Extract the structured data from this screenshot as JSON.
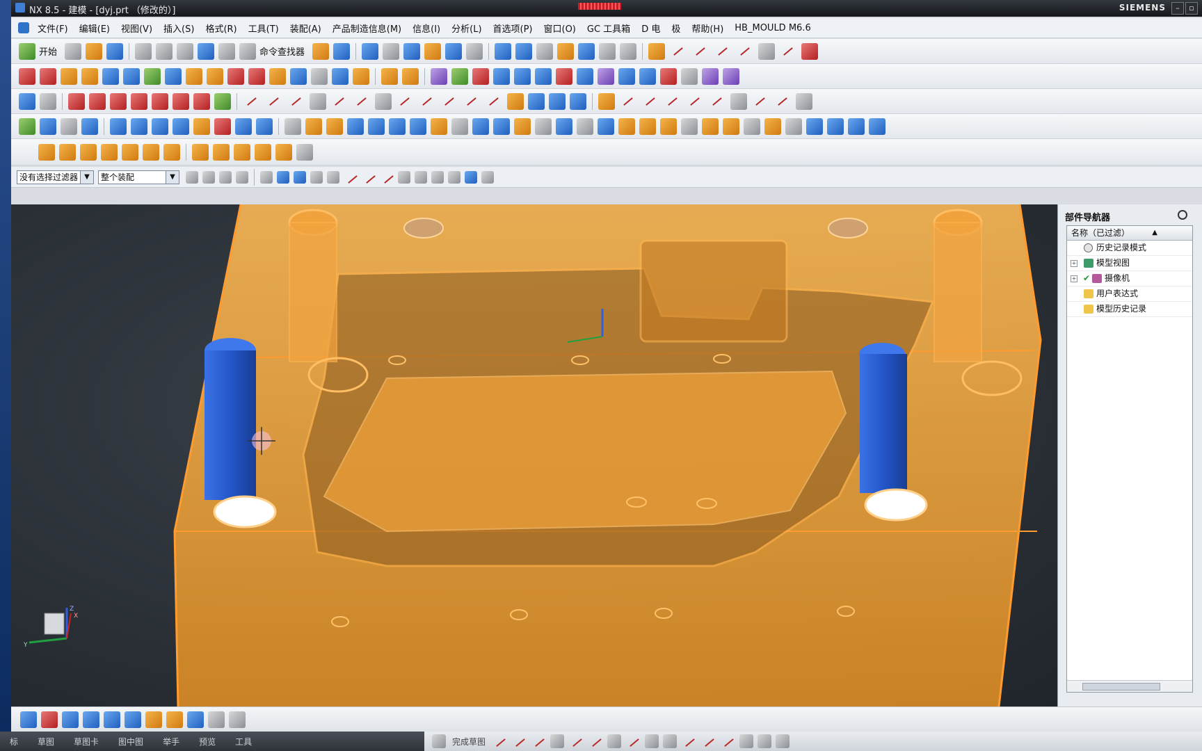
{
  "window": {
    "title": "NX 8.5 - 建模 - [dyj.prt （修改的）]",
    "brand": "SIEMENS",
    "min_button": "–",
    "restore_button": "▫"
  },
  "menubar": {
    "items": [
      "文件(F)",
      "编辑(E)",
      "视图(V)",
      "插入(S)",
      "格式(R)",
      "工具(T)",
      "装配(A)",
      "产品制造信息(M)",
      "信息(I)",
      "分析(L)",
      "首选项(P)",
      "窗口(O)",
      "GC 工具箱",
      "D 电",
      "极",
      "帮助(H)",
      "HB_MOULD M6.6"
    ]
  },
  "toolbar_standard": {
    "start_label": "开始",
    "command_finder_label": "命令查找器"
  },
  "filterbar": {
    "selection_filter": "没有选择过滤器",
    "assembly_scope": "整个装配"
  },
  "part_navigator": {
    "title": "部件导航器",
    "column_header": "名称（已过滤）",
    "sort_indicator": "▲",
    "items": [
      {
        "label": "历史记录模式",
        "icon": "clock-icon",
        "expandable": false,
        "checked": false
      },
      {
        "label": "模型视图",
        "icon": "model-views-icon",
        "expandable": true,
        "checked": false
      },
      {
        "label": "摄像机",
        "icon": "camera-icon",
        "expandable": true,
        "checked": true
      },
      {
        "label": "用户表达式",
        "icon": "folder-icon",
        "expandable": false,
        "checked": false
      },
      {
        "label": "模型历史记录",
        "icon": "folder-icon",
        "expandable": false,
        "checked": false
      }
    ]
  },
  "statusbar_tabs": [
    "标",
    "草图",
    "草图卡",
    "图中图",
    "举手",
    "预览",
    "工具"
  ],
  "sketch_bar": {
    "finish_sketch_label": "完成草图"
  },
  "viewport": {
    "triad_labels": {
      "x": "X",
      "y": "Y",
      "z": "Z"
    },
    "colors": {
      "body_fill": "#f2a23a",
      "body_edge": "#ff9b2f",
      "pillar": "#2a5fd6",
      "background": "#2b3138"
    }
  }
}
